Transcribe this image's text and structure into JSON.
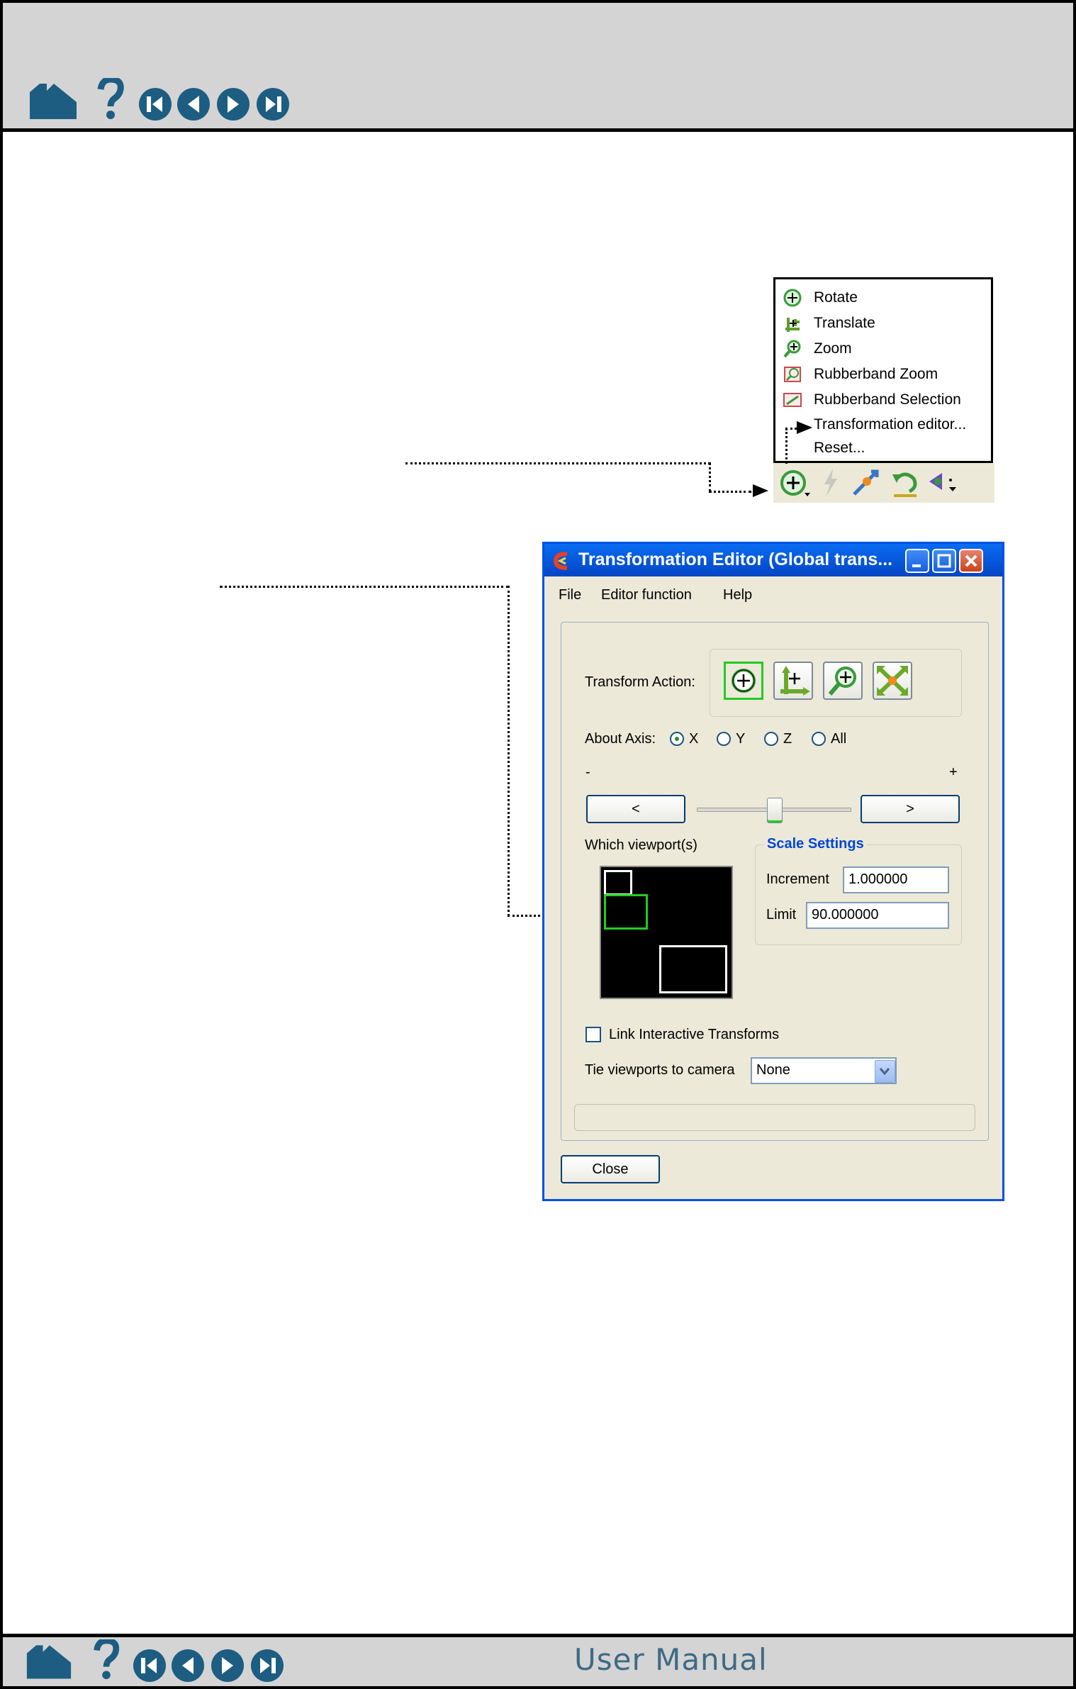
{
  "nav": {
    "icons": [
      "home-icon",
      "help-icon",
      "first-page-icon",
      "previous-page-icon",
      "next-page-icon",
      "last-page-icon"
    ]
  },
  "footer": {
    "title": "User Manual"
  },
  "menu": {
    "items": [
      {
        "label": "Rotate",
        "icon": "rotate-icon"
      },
      {
        "label": "Translate",
        "icon": "translate-icon"
      },
      {
        "label": "Zoom",
        "icon": "zoom-icon"
      },
      {
        "label": "Rubberband Zoom",
        "icon": "rubberband-zoom-icon"
      },
      {
        "label": "Rubberband Selection",
        "icon": "rubberband-selection-icon"
      },
      {
        "label": "Transformation editor...",
        "icon": ""
      },
      {
        "label": "Reset...",
        "icon": ""
      }
    ]
  },
  "window": {
    "title": "Transformation Editor (Global trans...",
    "menubar": [
      "File",
      "Editor function",
      "Help"
    ],
    "transform_action_label": "Transform Action:",
    "about_axis_label": "About Axis:",
    "axes": [
      "X",
      "Y",
      "Z",
      "All"
    ],
    "selected_axis": "X",
    "minus_label": "-",
    "plus_label": "+",
    "left_button": "<",
    "right_button": ">",
    "slider_position": 0.5,
    "viewports_label": "Which viewport(s)",
    "scale_settings_title": "Scale Settings",
    "increment_label": "Increment",
    "increment_value": "1.000000",
    "limit_label": "Limit",
    "limit_value": "90.000000",
    "link_checkbox_label": "Link Interactive Transforms",
    "link_checked": false,
    "tie_label": "Tie viewports to camera",
    "tie_value": "None",
    "close_button": "Close"
  },
  "colors": {
    "nav_blue": "#1d5d82",
    "xp_title_blue": "#0554d8",
    "accent_green": "#22cc22",
    "scale_settings_blue": "#0046d5"
  }
}
